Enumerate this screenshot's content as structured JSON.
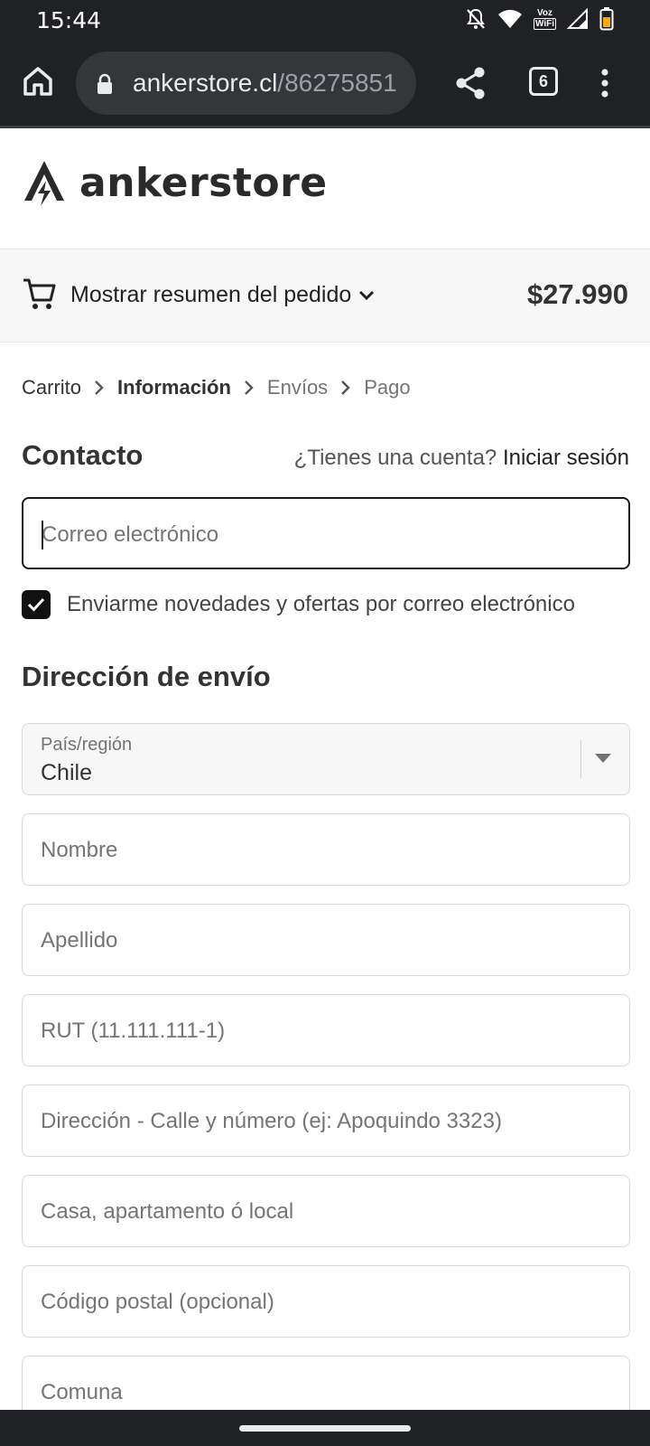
{
  "status_bar": {
    "time": "15:44",
    "icons": [
      "bell-off-icon",
      "wifi-icon",
      "voz-wifi-icon",
      "signal-icon",
      "battery-icon"
    ],
    "voz_top": "Voz",
    "voz_bottom": "WiFi"
  },
  "browser": {
    "url_domain": "ankerstore.cl",
    "url_path": "/86275851",
    "tab_count": "6",
    "icons": [
      "home-icon",
      "lock-icon",
      "share-icon",
      "tabs-icon",
      "more-vert-icon"
    ]
  },
  "store": {
    "logo_text": "ankerstore",
    "brand_color": "#2a2a2a"
  },
  "summary": {
    "toggle_label": "Mostrar resumen del pedido",
    "total": "$27.990"
  },
  "breadcrumb": {
    "items": [
      {
        "label": "Carrito",
        "state": "done"
      },
      {
        "label": "Información",
        "state": "current"
      },
      {
        "label": "Envíos",
        "state": "future"
      },
      {
        "label": "Pago",
        "state": "future"
      }
    ]
  },
  "contact": {
    "title": "Contacto",
    "account_prompt": "¿Tienes una cuenta?",
    "login_link": "Iniciar sesión",
    "email_placeholder": "Correo electrónico",
    "newsletter_label": "Enviarme novedades y ofertas por correo electrónico",
    "newsletter_checked": true
  },
  "shipping": {
    "title": "Dirección de envío",
    "country_label": "País/región",
    "country_value": "Chile",
    "fields": {
      "first_name": "Nombre",
      "last_name": "Apellido",
      "rut": "RUT (11.111.111-1)",
      "address": "Dirección - Calle y número (ej: Apoquindo 3323)",
      "apartment": "Casa, apartamento ó local",
      "postal_code": "Código postal (opcional)",
      "commune": "Comuna"
    }
  }
}
